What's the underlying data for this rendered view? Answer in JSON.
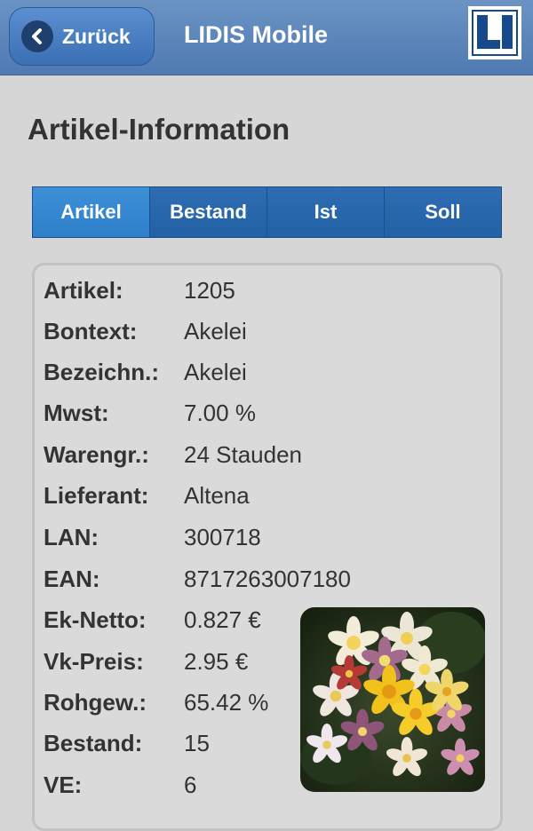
{
  "header": {
    "back_label": "Zurück",
    "title": "LIDIS Mobile",
    "logo_icon": "lidis-logo"
  },
  "page": {
    "title": "Artikel-Information"
  },
  "tabs": [
    {
      "label": "Artikel",
      "active": true
    },
    {
      "label": "Bestand",
      "active": false
    },
    {
      "label": "Ist",
      "active": false
    },
    {
      "label": "Soll",
      "active": false
    }
  ],
  "details": [
    {
      "label": "Artikel:",
      "value": "1205"
    },
    {
      "label": "Bontext:",
      "value": "Akelei"
    },
    {
      "label": "Bezeichn.:",
      "value": "Akelei"
    },
    {
      "label": "Mwst:",
      "value": "7.00 %"
    },
    {
      "label": "Warengr.:",
      "value": "24 Stauden"
    },
    {
      "label": "Lieferant:",
      "value": "Altena"
    },
    {
      "label": "LAN:",
      "value": "300718"
    },
    {
      "label": "EAN:",
      "value": "8717263007180"
    },
    {
      "label": "Ek-Netto:",
      "value": "0.827 €"
    },
    {
      "label": "Vk-Preis:",
      "value": "2.95 €"
    },
    {
      "label": "Rohgew.:",
      "value": "65.42 %"
    },
    {
      "label": "Bestand:",
      "value": "15"
    },
    {
      "label": "VE:",
      "value": "6"
    }
  ],
  "colors": {
    "header": "#5a86bd",
    "tab_active": "#3388d1",
    "tab": "#2563a8"
  }
}
